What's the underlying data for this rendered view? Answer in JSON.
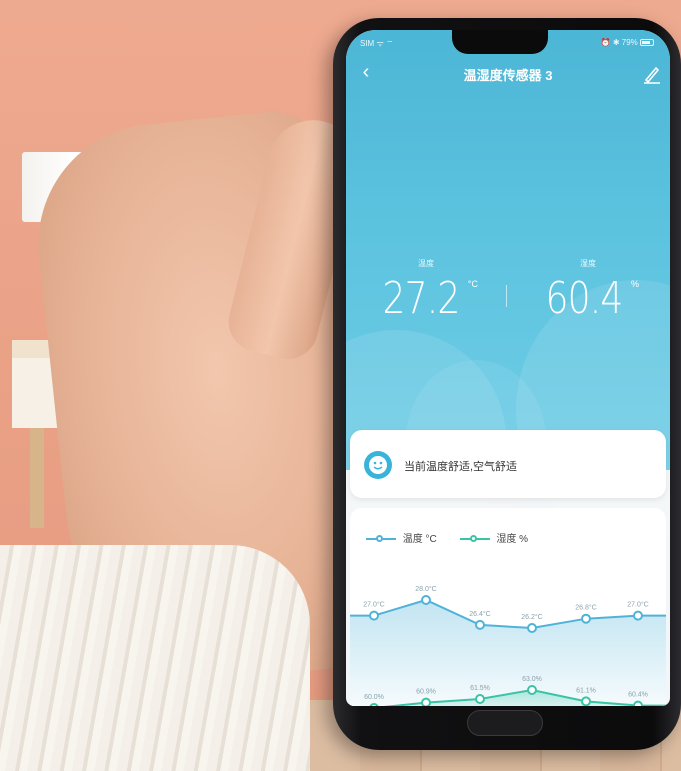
{
  "status_bar": {
    "carrier": "SIM ᯤ ⌔",
    "battery": "⏰ ✱ 79%"
  },
  "header": {
    "title": "温湿度传感器 3",
    "back_icon": "chevron-left-icon",
    "edit_icon": "pencil-icon"
  },
  "readings": {
    "temperature": {
      "label": "温度",
      "value": "27.2",
      "unit": "°C"
    },
    "humidity": {
      "label": "湿度",
      "value": "60.4",
      "unit": "%"
    }
  },
  "comfort": {
    "text": "当前温度舒适,空气舒适",
    "icon": "smile-face-icon"
  },
  "colors": {
    "accent": "#3ab3db",
    "temperature_line": "#4fb3d9",
    "humidity_line": "#39c4a6",
    "header_top": "#4cb6d6"
  },
  "chart_data": {
    "type": "line",
    "series": [
      {
        "name": "温度 °C",
        "values": [
          27.0,
          28.0,
          26.4,
          26.2,
          26.8,
          27.0
        ],
        "labels": [
          "27.0°C",
          "28.0°C",
          "26.4°C",
          "26.2°C",
          "26.8°C",
          "27.0°C"
        ]
      },
      {
        "name": "湿度 %",
        "values": [
          60.0,
          60.9,
          61.5,
          63.0,
          61.1,
          60.4
        ],
        "labels": [
          "60.0%",
          "60.9%",
          "61.5%",
          "63.0%",
          "61.1%",
          "60.4%"
        ]
      }
    ],
    "legend": [
      "温度 °C",
      "湿度 %"
    ],
    "legend_position": "top-left",
    "grid": false
  }
}
